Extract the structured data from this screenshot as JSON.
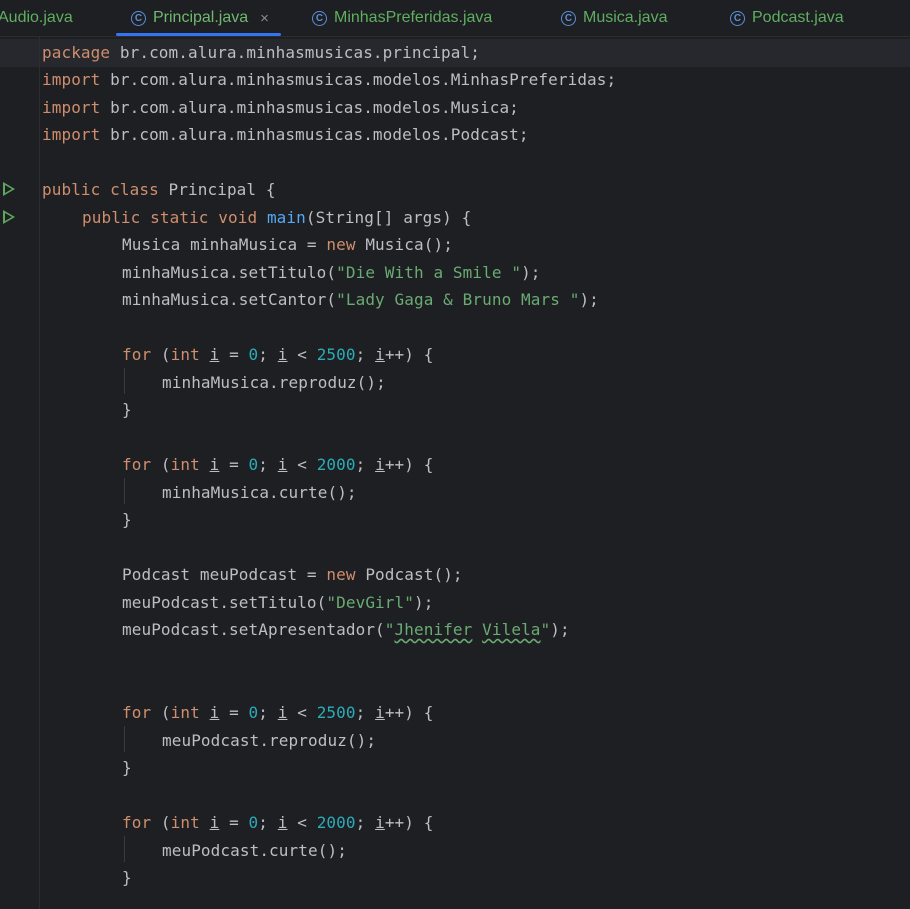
{
  "tabs": [
    {
      "label": "Audio.java",
      "active": false
    },
    {
      "label": "Principal.java",
      "active": true
    },
    {
      "label": "MinhasPreferidas.java",
      "active": false
    },
    {
      "label": "Musica.java",
      "active": false
    },
    {
      "label": "Podcast.java",
      "active": false
    }
  ],
  "tab_close_glyph": "×",
  "class_icon_glyph": "C",
  "colors": {
    "background": "#1e1f22",
    "keyword": "#cf8e6d",
    "string": "#6aab73",
    "number": "#2aacb8",
    "method_declaration": "#56a8f5",
    "text": "#bcbec4",
    "tab_text": "#5fae61",
    "active_tab_underline": "#3574f0",
    "run_icon": "#5fa65f"
  },
  "code": {
    "package_kw": "package",
    "package_name": " br.com.alura.minhasmusicas.principal;",
    "import_kw": "import",
    "import1": " br.com.alura.minhasmusicas.modelos.MinhasPreferidas;",
    "import2": " br.com.alura.minhasmusicas.modelos.Musica;",
    "import3": " br.com.alura.minhasmusicas.modelos.Podcast;",
    "public_kw": "public",
    "class_kw": "class",
    "class_name": " Principal {",
    "static_kw": "static",
    "void_kw": "void",
    "main_name": "main",
    "main_params": "(String[] args) {",
    "new_kw": "new",
    "for_kw": "for",
    "int_kw": "int",
    "var_i": "i",
    "musica_decl": "Musica minhaMusica = ",
    "musica_ctor": " Musica();",
    "set_titulo_m": "minhaMusica.setTitulo(",
    "titulo_m": "\"Die With a Smile \"",
    "set_cantor": "minhaMusica.setCantor(",
    "cantor": "\"Lady Gaga & Bruno Mars \"",
    "end_call": ");",
    "loop_mid1": " = ",
    "zero": "0",
    "loop_lt": "; ",
    "loop_lt2": " < ",
    "n2500": "2500",
    "n2000": "2000",
    "loop_inc": "++) {",
    "open_paren": " (",
    "musica_reproduz": "minhaMusica.reproduz();",
    "musica_curte": "minhaMusica.curte();",
    "close_brace": "}",
    "podcast_decl": "Podcast meuPodcast = ",
    "podcast_ctor": " Podcast();",
    "set_titulo_p": "meuPodcast.setTitulo(",
    "titulo_p": "\"DevGirl\"",
    "set_apresentador": "meuPodcast.setApresentador(",
    "q": "\"",
    "apres_first": "Jhenifer",
    "space": " ",
    "apres_last": "Vilela",
    "podcast_reproduz": "meuPodcast.reproduz();",
    "podcast_curte": "meuPodcast.curte();"
  }
}
